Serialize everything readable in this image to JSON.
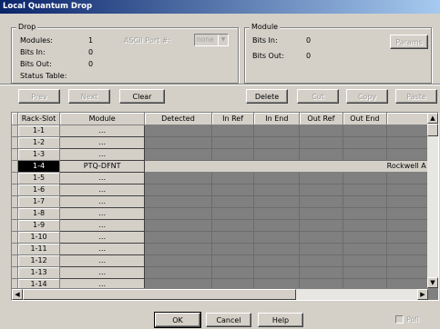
{
  "window": {
    "title": "Local Quantum Drop"
  },
  "drop": {
    "legend": "Drop",
    "modules_label": "Modules:",
    "modules_value": "1",
    "bits_in_label": "Bits In:",
    "bits_in_value": "0",
    "bits_out_label": "Bits Out:",
    "bits_out_value": "0",
    "status_table_label": "Status Table:",
    "ascii_port_label": "ASCII Port #:",
    "ascii_port_value": "none"
  },
  "module": {
    "legend": "Module",
    "bits_in_label": "Bits In:",
    "bits_in_value": "0",
    "bits_out_label": "Bits Out:",
    "bits_out_value": "0",
    "params_label": "Params"
  },
  "toolbar": {
    "prev_label": "Prev",
    "next_label": "Next",
    "clear_label": "Clear",
    "delete_label": "Delete",
    "cut_label": "Cut",
    "copy_label": "Copy",
    "paste_label": "Paste"
  },
  "grid": {
    "columns": [
      "Rack-Slot",
      "Module",
      "Detected",
      "In Ref",
      "In End",
      "Out Ref",
      "Out End"
    ],
    "rows": [
      {
        "slot": "1-1",
        "module": "...",
        "detected": ""
      },
      {
        "slot": "1-2",
        "module": "...",
        "detected": ""
      },
      {
        "slot": "1-3",
        "module": "...",
        "detected": ""
      },
      {
        "slot": "1-4",
        "module": "PTQ-DFNT",
        "detected": "Rockwell A"
      },
      {
        "slot": "1-5",
        "module": "...",
        "detected": ""
      },
      {
        "slot": "1-6",
        "module": "...",
        "detected": ""
      },
      {
        "slot": "1-7",
        "module": "...",
        "detected": ""
      },
      {
        "slot": "1-8",
        "module": "...",
        "detected": ""
      },
      {
        "slot": "1-9",
        "module": "...",
        "detected": ""
      },
      {
        "slot": "1-10",
        "module": "...",
        "detected": ""
      },
      {
        "slot": "1-11",
        "module": "...",
        "detected": ""
      },
      {
        "slot": "1-12",
        "module": "...",
        "detected": ""
      },
      {
        "slot": "1-13",
        "module": "...",
        "detected": ""
      },
      {
        "slot": "1-14",
        "module": "...",
        "detected": ""
      }
    ],
    "selected_row": "1-4"
  },
  "footer": {
    "ok_label": "OK",
    "cancel_label": "Cancel",
    "help_label": "Help",
    "poll_label": "Poll"
  },
  "colors": {
    "titlebar_start": "#0a246a",
    "titlebar_end": "#a6caf0",
    "window_bg": "#d4d0c8",
    "grid_bg": "#808080"
  },
  "icons": {
    "scroll_up": "scroll-up-icon",
    "scroll_down": "scroll-down-icon",
    "scroll_left": "scroll-left-icon",
    "scroll_right": "scroll-right-icon",
    "dropdown": "chevron-down-icon"
  }
}
